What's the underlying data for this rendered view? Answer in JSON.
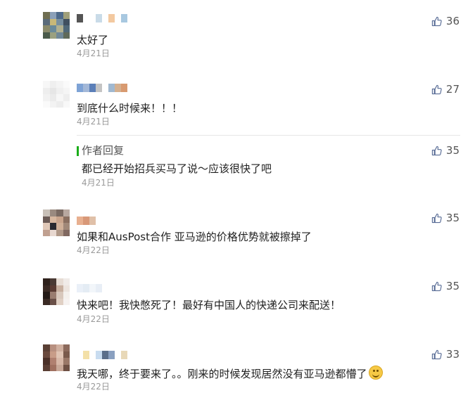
{
  "comments": [
    {
      "text": "太好了",
      "date": "4月21日",
      "likes": "36",
      "avatar_colors": [
        "#6b6b4a",
        "#4a6b8a",
        "#8aa06b",
        "#506070"
      ]
    },
    {
      "text": "到底什么时候来！！！",
      "date": "4月21日",
      "likes": "27",
      "avatar_colors": [
        "#f0f0f0",
        "#ececec",
        "#f4f4f4",
        "#e8e8e8"
      ]
    },
    {
      "text": "如果和AusPost合作 亚马逊的价格优势就被擦掉了",
      "date": "4月22日",
      "likes": "35",
      "avatar_colors": [
        "#8a6f60",
        "#c9a48c",
        "#6a5a55",
        "#d8b8a0"
      ]
    },
    {
      "text": "快来吧！我快憋死了！最好有中国人的快递公司来配送！",
      "date": "4月22日",
      "likes": "35",
      "avatar_colors": [
        "#2e211c",
        "#5a3b33",
        "#e6dcd4",
        "#9a7d70"
      ]
    },
    {
      "text": "我天哪，终于要来了。。刚来的时候发现居然没有亚马逊都懵了",
      "date": "4月22日",
      "likes": "33",
      "avatar_colors": [
        "#5a4035",
        "#b89080",
        "#8c6a5c",
        "#d0b0a0"
      ]
    }
  ],
  "author_reply": {
    "label": "作者回复",
    "text": "都已经开始招兵买马了说～应该很快了吧",
    "date": "4月21日",
    "likes": "35"
  },
  "colors": {
    "accent_green": "#1aad19",
    "like_icon": "#576b95",
    "date_gray": "#9a9a9a"
  },
  "icons": {
    "like": "thumbs-up-icon",
    "emoji": "smile-emoji-icon"
  }
}
